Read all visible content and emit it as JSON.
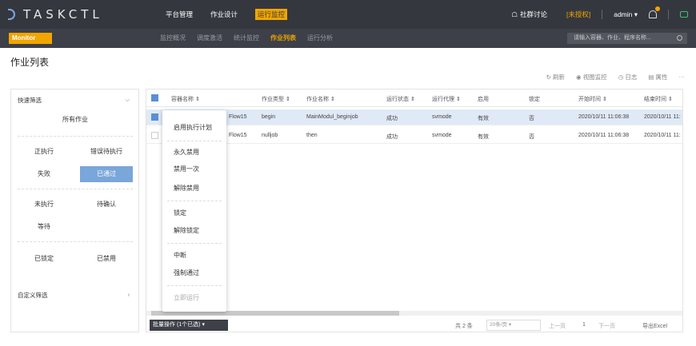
{
  "app": {
    "logo_text": "TASKCTL"
  },
  "topnav": {
    "items": [
      "平台管理",
      "作业设计",
      "运行监控"
    ],
    "active_index": 2
  },
  "topright": {
    "community": "社群讨论",
    "unauthorized": "[未授权]",
    "user": "admin ▾"
  },
  "subbar": {
    "monitor_label": "Monitor",
    "items": [
      "监控概况",
      "调度激活",
      "统计监控",
      "作业列表",
      "运行分析"
    ],
    "active_index": 3,
    "search_placeholder": "请输入容器、作业、程序名称..."
  },
  "page": {
    "title": "作业列表"
  },
  "toolbar": {
    "refresh": "刷新",
    "view_monitor": "视图监控",
    "log": "日志",
    "properties": "属性",
    "more": "···"
  },
  "sidebar": {
    "quick_filter": "快速筛选",
    "all_jobs": "所有作业",
    "running": "正执行",
    "error_waiting": "错误待执行",
    "failed": "失败",
    "passed": "已通过",
    "not_executed": "未执行",
    "pending_confirm": "待确认",
    "waiting": "等待",
    "locked": "已锁定",
    "disabled": "已禁用",
    "custom_filter": "自定义筛选"
  },
  "table": {
    "headers": [
      "容器名称 ⇕",
      "作业类型 ⇕",
      "作业名称 ⇕",
      "运行状态 ⇕",
      "运行代理 ⇕",
      "启用",
      "锁定",
      "开始时间 ⇕",
      "结束时间 ⇕"
    ],
    "rows": [
      {
        "container": "Flow15",
        "type": "begin",
        "name": "MainModul_beginjob",
        "status": "成功",
        "agent": "svmode",
        "enabled": "有效",
        "locked": "否",
        "start": "2020/10/11 11:06:38",
        "end": "2020/10/11 11:",
        "selected": true
      },
      {
        "container": "Flow15",
        "type": "nulljob",
        "name": "then",
        "status": "成功",
        "agent": "svmode",
        "enabled": "有效",
        "locked": "否",
        "start": "2020/10/11 11:06:38",
        "end": "2020/10/11 11:",
        "selected": false
      }
    ]
  },
  "footer": {
    "batch": "批量操作 (1个已选) ▾",
    "total": "共 2 条",
    "page_size": "20条/页 ▾",
    "prev": "上一页",
    "page": "1",
    "next": "下一页",
    "export": "导出Excel"
  },
  "context_menu": {
    "items": [
      "启用执行计划",
      "永久禁用",
      "禁用一次",
      "解除禁用",
      "锁定",
      "解除锁定",
      "中断",
      "强制通过",
      "立即运行"
    ]
  }
}
